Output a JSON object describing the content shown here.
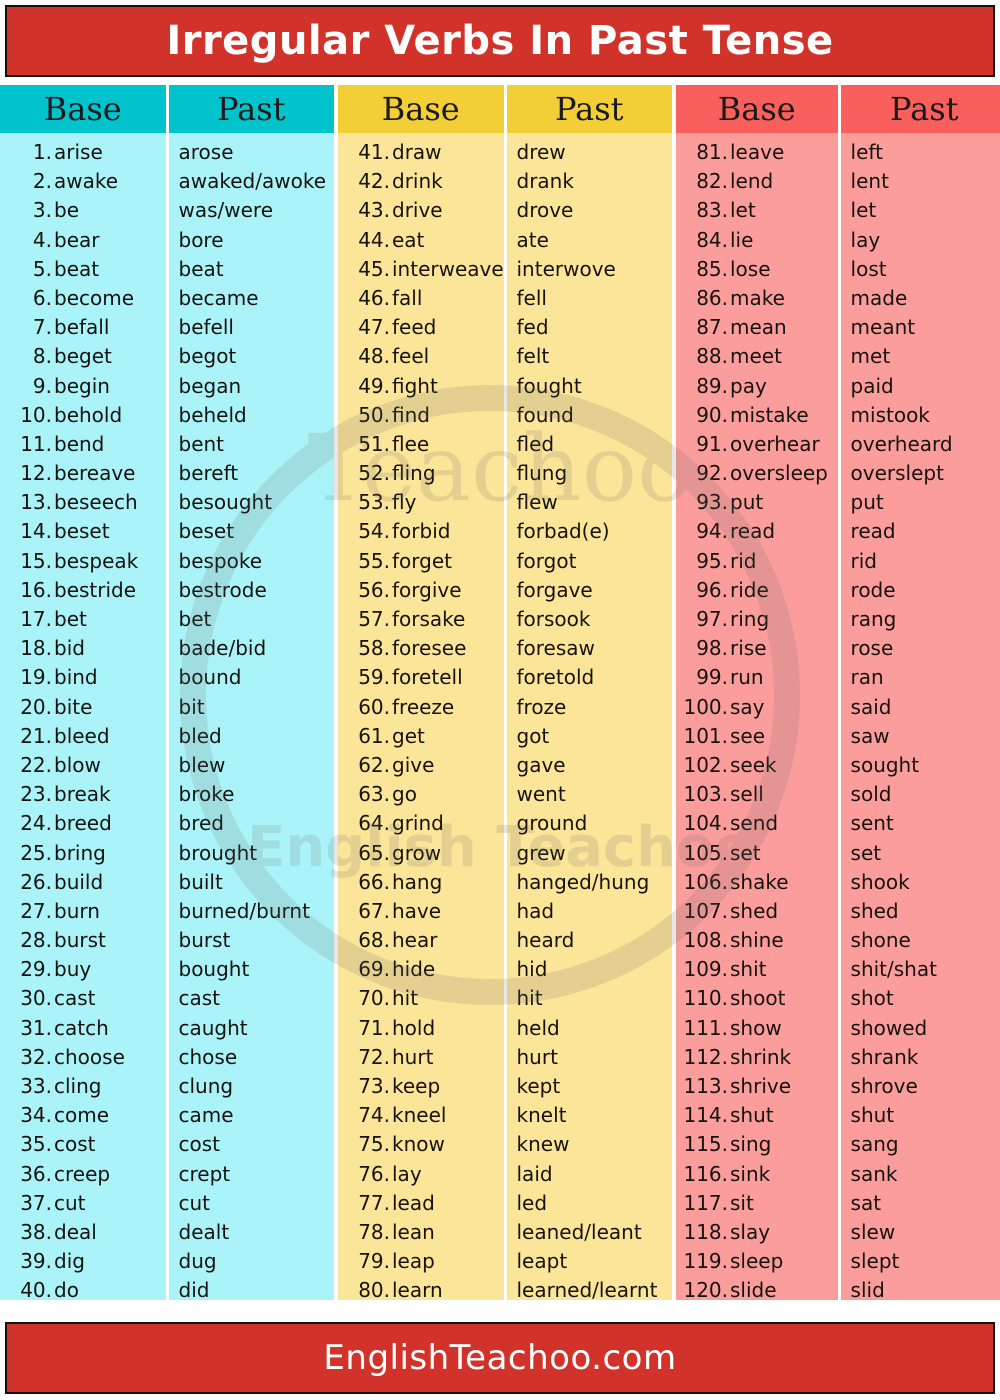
{
  "header": {
    "title": "Irregular Verbs In Past Tense"
  },
  "footer": {
    "site": "EnglishTeachoo.com"
  },
  "watermark": {
    "brand": "Teachoo",
    "tagline": "English Teachoo"
  },
  "colors": {
    "banner_red": "#d13229",
    "banner_border": "#111111",
    "banner_text": "#ffffff",
    "teal_header": "#00c3cc",
    "teal_body": "#aaf4f9",
    "yellow_header": "#f2cf36",
    "yellow_body": "#fbe598",
    "pink_header": "#f95f5c",
    "pink_body": "#fb9d9b",
    "text": "#16130f"
  },
  "columns": [
    {
      "id": "group-1",
      "theme": "teal",
      "headers": {
        "base": "Base",
        "past": "Past"
      },
      "rows": [
        {
          "n": "1.",
          "base": "arise",
          "past": "arose"
        },
        {
          "n": "2.",
          "base": "awake",
          "past": "awaked/awoke"
        },
        {
          "n": "3.",
          "base": "be",
          "past": "was/were"
        },
        {
          "n": "4.",
          "base": "bear",
          "past": "bore"
        },
        {
          "n": "5.",
          "base": "beat",
          "past": "beat"
        },
        {
          "n": "6.",
          "base": "become",
          "past": "became"
        },
        {
          "n": "7.",
          "base": "befall",
          "past": "befell"
        },
        {
          "n": "8.",
          "base": "beget",
          "past": "begot"
        },
        {
          "n": "9.",
          "base": "begin",
          "past": "began"
        },
        {
          "n": "10.",
          "base": "behold",
          "past": "beheld"
        },
        {
          "n": "11.",
          "base": "bend",
          "past": "bent"
        },
        {
          "n": "12.",
          "base": "bereave",
          "past": "bereft"
        },
        {
          "n": "13.",
          "base": "beseech",
          "past": "besought"
        },
        {
          "n": "14.",
          "base": "beset",
          "past": "beset"
        },
        {
          "n": "15.",
          "base": "bespeak",
          "past": "bespoke"
        },
        {
          "n": "16.",
          "base": "bestride",
          "past": "bestrode"
        },
        {
          "n": "17.",
          "base": "bet",
          "past": "bet"
        },
        {
          "n": "18.",
          "base": "bid",
          "past": "bade/bid"
        },
        {
          "n": "19.",
          "base": "bind",
          "past": "bound"
        },
        {
          "n": "20.",
          "base": "bite",
          "past": "bit"
        },
        {
          "n": "21.",
          "base": "bleed",
          "past": "bled"
        },
        {
          "n": "22.",
          "base": "blow",
          "past": "blew"
        },
        {
          "n": "23.",
          "base": "break",
          "past": "broke"
        },
        {
          "n": "24.",
          "base": "breed",
          "past": "bred"
        },
        {
          "n": "25.",
          "base": "bring",
          "past": "brought"
        },
        {
          "n": "26.",
          "base": "build",
          "past": "built"
        },
        {
          "n": "27.",
          "base": "burn",
          "past": "burned/burnt"
        },
        {
          "n": "28.",
          "base": "burst",
          "past": "burst"
        },
        {
          "n": "29.",
          "base": "buy",
          "past": "bought"
        },
        {
          "n": "30.",
          "base": "cast",
          "past": "cast"
        },
        {
          "n": "31.",
          "base": "catch",
          "past": "caught"
        },
        {
          "n": "32.",
          "base": "choose",
          "past": "chose"
        },
        {
          "n": "33.",
          "base": "cling",
          "past": "clung"
        },
        {
          "n": "34.",
          "base": "come",
          "past": "came"
        },
        {
          "n": "35.",
          "base": "cost",
          "past": "cost"
        },
        {
          "n": "36.",
          "base": "creep",
          "past": "crept"
        },
        {
          "n": "37.",
          "base": "cut",
          "past": "cut"
        },
        {
          "n": "38.",
          "base": "deal",
          "past": "dealt"
        },
        {
          "n": "39.",
          "base": "dig",
          "past": "dug"
        },
        {
          "n": "40.",
          "base": "do",
          "past": "did"
        }
      ]
    },
    {
      "id": "group-2",
      "theme": "yellow",
      "headers": {
        "base": "Base",
        "past": "Past"
      },
      "rows": [
        {
          "n": "41.",
          "base": " draw",
          "past": "drew"
        },
        {
          "n": "42.",
          "base": " drink",
          "past": "drank"
        },
        {
          "n": "43.",
          "base": "drive",
          "past": "drove"
        },
        {
          "n": "44.",
          "base": "eat",
          "past": "ate"
        },
        {
          "n": "45.",
          "base": "interweave",
          "past": "interwove"
        },
        {
          "n": "46.",
          "base": "fall",
          "past": "fell"
        },
        {
          "n": "47.",
          "base": "feed",
          "past": "fed"
        },
        {
          "n": "48.",
          "base": "feel",
          "past": "felt"
        },
        {
          "n": "49.",
          "base": "fight",
          "past": "fought"
        },
        {
          "n": "50.",
          "base": "find",
          "past": "found"
        },
        {
          "n": "51.",
          "base": "flee",
          "past": "fled"
        },
        {
          "n": "52.",
          "base": "fling",
          "past": "flung"
        },
        {
          "n": "53.",
          "base": "fly",
          "past": "flew"
        },
        {
          "n": "54.",
          "base": "forbid",
          "past": "forbad(e)"
        },
        {
          "n": "55.",
          "base": "forget",
          "past": "forgot"
        },
        {
          "n": "56.",
          "base": "forgive",
          "past": "forgave"
        },
        {
          "n": "57.",
          "base": "forsake",
          "past": "forsook"
        },
        {
          "n": "58.",
          "base": "foresee",
          "past": "foresaw"
        },
        {
          "n": "59.",
          "base": "foretell",
          "past": "foretold"
        },
        {
          "n": "60.",
          "base": "freeze",
          "past": "froze"
        },
        {
          "n": "61.",
          "base": "get",
          "past": "got"
        },
        {
          "n": "62.",
          "base": "give",
          "past": "gave"
        },
        {
          "n": "63.",
          "base": "go",
          "past": "went"
        },
        {
          "n": "64.",
          "base": "grind",
          "past": "ground"
        },
        {
          "n": "65.",
          "base": "grow",
          "past": "grew"
        },
        {
          "n": "66.",
          "base": "hang",
          "past": "hanged/hung"
        },
        {
          "n": "67.",
          "base": "have",
          "past": "had"
        },
        {
          "n": "68.",
          "base": "hear",
          "past": "heard"
        },
        {
          "n": "69.",
          "base": "hide",
          "past": "hid"
        },
        {
          "n": "70.",
          "base": "hit",
          "past": "hit"
        },
        {
          "n": "71.",
          "base": "hold",
          "past": "held"
        },
        {
          "n": "72.",
          "base": "hurt",
          "past": "hurt"
        },
        {
          "n": "73.",
          "base": "keep",
          "past": "kept"
        },
        {
          "n": "74.",
          "base": "kneel",
          "past": "knelt"
        },
        {
          "n": "75.",
          "base": "know",
          "past": "knew"
        },
        {
          "n": "76.",
          "base": "lay",
          "past": "laid"
        },
        {
          "n": "77.",
          "base": "lead",
          "past": "led"
        },
        {
          "n": "78.",
          "base": "lean",
          "past": "leaned/leant"
        },
        {
          "n": "79.",
          "base": "leap",
          "past": "leapt"
        },
        {
          "n": "80.",
          "base": "learn",
          "past": "learned/learnt"
        }
      ]
    },
    {
      "id": "group-3",
      "theme": "pink",
      "headers": {
        "base": "Base",
        "past": "Past"
      },
      "rows": [
        {
          "n": "81.",
          "base": "leave",
          "past": "left"
        },
        {
          "n": "82.",
          "base": "lend",
          "past": "lent"
        },
        {
          "n": "83.",
          "base": "let",
          "past": "let"
        },
        {
          "n": "84.",
          "base": "lie",
          "past": "lay"
        },
        {
          "n": "85.",
          "base": "lose",
          "past": "lost"
        },
        {
          "n": "86.",
          "base": "make",
          "past": "made"
        },
        {
          "n": "87.",
          "base": "mean",
          "past": "meant"
        },
        {
          "n": "88.",
          "base": "meet",
          "past": "met"
        },
        {
          "n": "89.",
          "base": "pay",
          "past": "paid"
        },
        {
          "n": "90.",
          "base": "mistake",
          "past": "mistook"
        },
        {
          "n": "91.",
          "base": "overhear",
          "past": "overheard"
        },
        {
          "n": "92.",
          "base": "oversleep",
          "past": "overslept"
        },
        {
          "n": "93.",
          "base": "put",
          "past": "put"
        },
        {
          "n": "94.",
          "base": "read",
          "past": "read"
        },
        {
          "n": "95.",
          "base": "rid",
          "past": "rid"
        },
        {
          "n": "96.",
          "base": "ride",
          "past": "rode"
        },
        {
          "n": "97.",
          "base": "ring",
          "past": "rang"
        },
        {
          "n": "98.",
          "base": "rise",
          "past": "rose"
        },
        {
          "n": "99.",
          "base": "run",
          "past": "ran"
        },
        {
          "n": "100.",
          "base": "say",
          "past": "said"
        },
        {
          "n": "101.",
          "base": "see",
          "past": "saw"
        },
        {
          "n": "102.",
          "base": "seek",
          "past": "sought"
        },
        {
          "n": "103.",
          "base": "sell",
          "past": "sold"
        },
        {
          "n": "104.",
          "base": "send",
          "past": "sent"
        },
        {
          "n": "105.",
          "base": "set",
          "past": "set"
        },
        {
          "n": "106.",
          "base": "shake",
          "past": "shook"
        },
        {
          "n": "107.",
          "base": "shed",
          "past": "shed"
        },
        {
          "n": "108.",
          "base": "shine",
          "past": "shone"
        },
        {
          "n": "109.",
          "base": "shit",
          "past": "shit/shat"
        },
        {
          "n": "110.",
          "base": "shoot",
          "past": "shot"
        },
        {
          "n": "111.",
          "base": "show",
          "past": "showed"
        },
        {
          "n": "112.",
          "base": "shrink",
          "past": "shrank"
        },
        {
          "n": "113.",
          "base": "shrive",
          "past": "shrove"
        },
        {
          "n": "114.",
          "base": "shut",
          "past": "shut"
        },
        {
          "n": "115.",
          "base": "sing",
          "past": "sang"
        },
        {
          "n": "116.",
          "base": "sink",
          "past": "sank"
        },
        {
          "n": "117.",
          "base": "sit",
          "past": "sat"
        },
        {
          "n": "118.",
          "base": "slay",
          "past": "slew"
        },
        {
          "n": "119.",
          "base": "sleep",
          "past": "slept"
        },
        {
          "n": "120.",
          "base": "slide",
          "past": "slid"
        }
      ]
    }
  ]
}
